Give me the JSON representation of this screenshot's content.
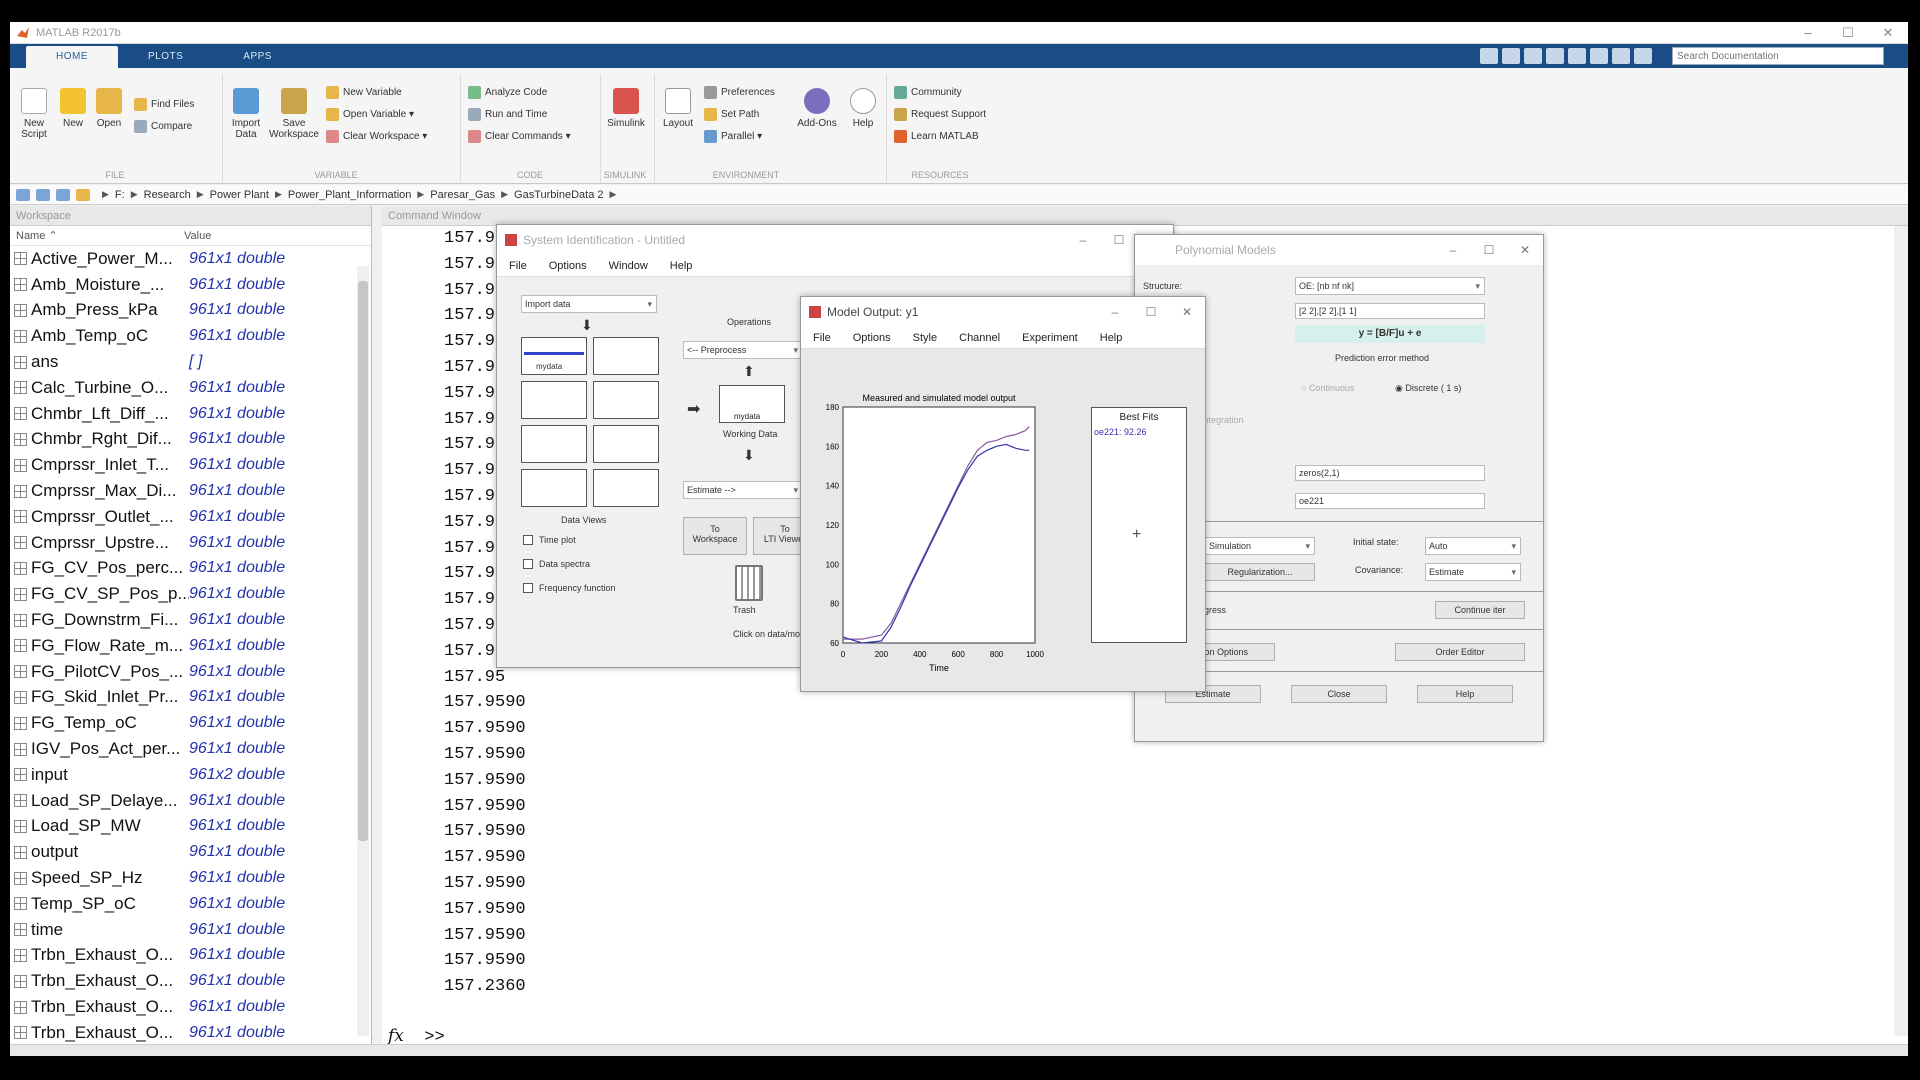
{
  "app": {
    "title": "MATLAB R2017b"
  },
  "ribbon": {
    "tabs": [
      "HOME",
      "PLOTS",
      "APPS"
    ],
    "search_placeholder": "Search Documentation",
    "file": {
      "new_script": "New\nScript",
      "new": "New",
      "open": "Open",
      "find_files": "Find Files",
      "compare": "Compare",
      "group": "FILE"
    },
    "variable": {
      "import_data": "Import\nData",
      "save_workspace": "Save\nWorkspace",
      "new_variable": "New Variable",
      "open_variable": "Open Variable ▾",
      "clear_workspace": "Clear Workspace ▾",
      "group": "VARIABLE"
    },
    "code": {
      "analyze_code": "Analyze Code",
      "run_and_time": "Run and Time",
      "clear_commands": "Clear Commands ▾",
      "group": "CODE"
    },
    "simulink": {
      "simulink": "Simulink",
      "group": "SIMULINK"
    },
    "environment": {
      "layout": "Layout",
      "preferences": "Preferences",
      "set_path": "Set Path",
      "parallel": "Parallel ▾",
      "addons": "Add-Ons",
      "help": "Help",
      "group": "ENVIRONMENT"
    },
    "resources": {
      "community": "Community",
      "request_support": "Request Support",
      "learn_matlab": "Learn MATLAB",
      "group": "RESOURCES"
    }
  },
  "address": {
    "crumbs": [
      "F:",
      "Research",
      "Power Plant",
      "Power_Plant_Information",
      "Paresar_Gas",
      "GasTurbineData 2"
    ]
  },
  "workspace": {
    "title": "Workspace",
    "col_name": "Name ⌃",
    "col_value": "Value",
    "vars": [
      {
        "name": "Active_Power_M...",
        "value": "961x1 double"
      },
      {
        "name": "Amb_Moisture_...",
        "value": "961x1 double"
      },
      {
        "name": "Amb_Press_kPa",
        "value": "961x1 double"
      },
      {
        "name": "Amb_Temp_oC",
        "value": "961x1 double"
      },
      {
        "name": "ans",
        "value": "[ ]"
      },
      {
        "name": "Calc_Turbine_O...",
        "value": "961x1 double"
      },
      {
        "name": "Chmbr_Lft_Diff_...",
        "value": "961x1 double"
      },
      {
        "name": "Chmbr_Rght_Dif...",
        "value": "961x1 double"
      },
      {
        "name": "Cmprssr_Inlet_T...",
        "value": "961x1 double"
      },
      {
        "name": "Cmprssr_Max_Di...",
        "value": "961x1 double"
      },
      {
        "name": "Cmprssr_Outlet_...",
        "value": "961x1 double"
      },
      {
        "name": "Cmprssr_Upstre...",
        "value": "961x1 double"
      },
      {
        "name": "FG_CV_Pos_perc...",
        "value": "961x1 double"
      },
      {
        "name": "FG_CV_SP_Pos_p...",
        "value": "961x1 double"
      },
      {
        "name": "FG_Downstrm_Fi...",
        "value": "961x1 double"
      },
      {
        "name": "FG_Flow_Rate_m...",
        "value": "961x1 double"
      },
      {
        "name": "FG_PilotCV_Pos_...",
        "value": "961x1 double"
      },
      {
        "name": "FG_Skid_Inlet_Pr...",
        "value": "961x1 double"
      },
      {
        "name": "FG_Temp_oC",
        "value": "961x1 double"
      },
      {
        "name": "IGV_Pos_Act_per...",
        "value": "961x1 double"
      },
      {
        "name": "input",
        "value": "961x2 double"
      },
      {
        "name": "Load_SP_Delaye...",
        "value": "961x1 double"
      },
      {
        "name": "Load_SP_MW",
        "value": "961x1 double"
      },
      {
        "name": "output",
        "value": "961x1 double"
      },
      {
        "name": "Speed_SP_Hz",
        "value": "961x1 double"
      },
      {
        "name": "Temp_SP_oC",
        "value": "961x1 double"
      },
      {
        "name": "time",
        "value": "961x1 double"
      },
      {
        "name": "Trbn_Exhaust_O...",
        "value": "961x1 double"
      },
      {
        "name": "Trbn_Exhaust_O...",
        "value": "961x1 double"
      },
      {
        "name": "Trbn_Exhaust_O...",
        "value": "961x1 double"
      },
      {
        "name": "Trbn_Exhaust_O...",
        "value": "961x1 double"
      }
    ]
  },
  "command_window": {
    "title": "Command Window",
    "lines": [
      "157.9590",
      "157.95",
      "157.95",
      "157.95",
      "157.95",
      "157.95",
      "157.95",
      "157.95",
      "157.95",
      "157.95",
      "157.95",
      "157.95",
      "157.95",
      "157.95",
      "157.95",
      "157.95",
      "157.95",
      "157.95",
      "157.9590",
      "157.9590",
      "157.9590",
      "157.9590",
      "157.9590",
      "157.9590",
      "157.9590",
      "157.9590",
      "157.9590",
      "157.9590",
      "157.9590",
      "157.2360"
    ],
    "prompt": ">>"
  },
  "sysid": {
    "title": "System Identification - Untitled",
    "menu": [
      "File",
      "Options",
      "Window",
      "Help"
    ],
    "import_data": "Import data",
    "data_label": "mydata",
    "operations": "Operations",
    "preprocess": "<-- Preprocess",
    "working_data_box": "mydata",
    "working_data": "Working Data",
    "estimate": "Estimate -->",
    "data_views": "Data Views",
    "time_plot": "Time plot",
    "data_spectra": "Data spectra",
    "frequency_function": "Frequency function",
    "to_workspace": "To\nWorkspace",
    "to_lti_viewer": "To\nLTI Viewer",
    "trash": "Trash",
    "hint": "Click on data/mod"
  },
  "poly": {
    "title": "Polynomial Models",
    "structure_label": "Structure:",
    "structure": "OE: [nb nf nk]",
    "orders": "[2 2],[2 2],[1 1]",
    "equation": "y = [B/F]u + e",
    "method": "Prediction error method",
    "continuous": "Continuous",
    "discrete": "Discrete ( 1 s)",
    "integration": "Add noise integration",
    "delay_field": "zeros(2,1)",
    "name_field": "oe221",
    "focus": "Simulation",
    "regularization": "Regularization...",
    "initial_state_label": "Initial state:",
    "initial_state": "Auto",
    "covariance_label": "Covariance:",
    "covariance": "Estimate",
    "progress": "Display progress",
    "continue_iter": "Continue iter",
    "options": "Iteration Options",
    "order_editor": "Order Editor",
    "estimate": "Estimate",
    "close": "Close",
    "help": "Help"
  },
  "model_output": {
    "title": "Model Output: y1",
    "menu": [
      "File",
      "Options",
      "Style",
      "Channel",
      "Experiment",
      "Help"
    ],
    "best_fits": "Best Fits",
    "fit_entry": "oe221: 92.26",
    "plus": "+"
  },
  "chart_data": {
    "type": "line",
    "title": "Measured and simulated model output",
    "xlabel": "Time",
    "ylabel": "",
    "xlim": [
      0,
      1000
    ],
    "ylim": [
      60,
      180
    ],
    "xticks": [
      0,
      200,
      400,
      600,
      800,
      1000
    ],
    "yticks": [
      60,
      80,
      100,
      120,
      140,
      160,
      180
    ],
    "series": [
      {
        "name": "measured",
        "color": "#8a5aa0",
        "x": [
          0,
          100,
          200,
          250,
          300,
          350,
          400,
          450,
          500,
          550,
          600,
          650,
          700,
          750,
          800,
          850,
          900,
          950,
          970
        ],
        "y": [
          62,
          62,
          64,
          70,
          80,
          90,
          100,
          110,
          120,
          130,
          140,
          150,
          158,
          162,
          163,
          165,
          166,
          168,
          170
        ]
      },
      {
        "name": "oe221",
        "color": "#3333aa",
        "x": [
          0,
          100,
          200,
          250,
          300,
          350,
          400,
          450,
          500,
          550,
          600,
          650,
          700,
          750,
          800,
          850,
          900,
          950,
          970
        ],
        "y": [
          63,
          60,
          61,
          68,
          78,
          89,
          99,
          109,
          119,
          129,
          139,
          148,
          155,
          158,
          160,
          161,
          159,
          158,
          158
        ]
      }
    ]
  }
}
